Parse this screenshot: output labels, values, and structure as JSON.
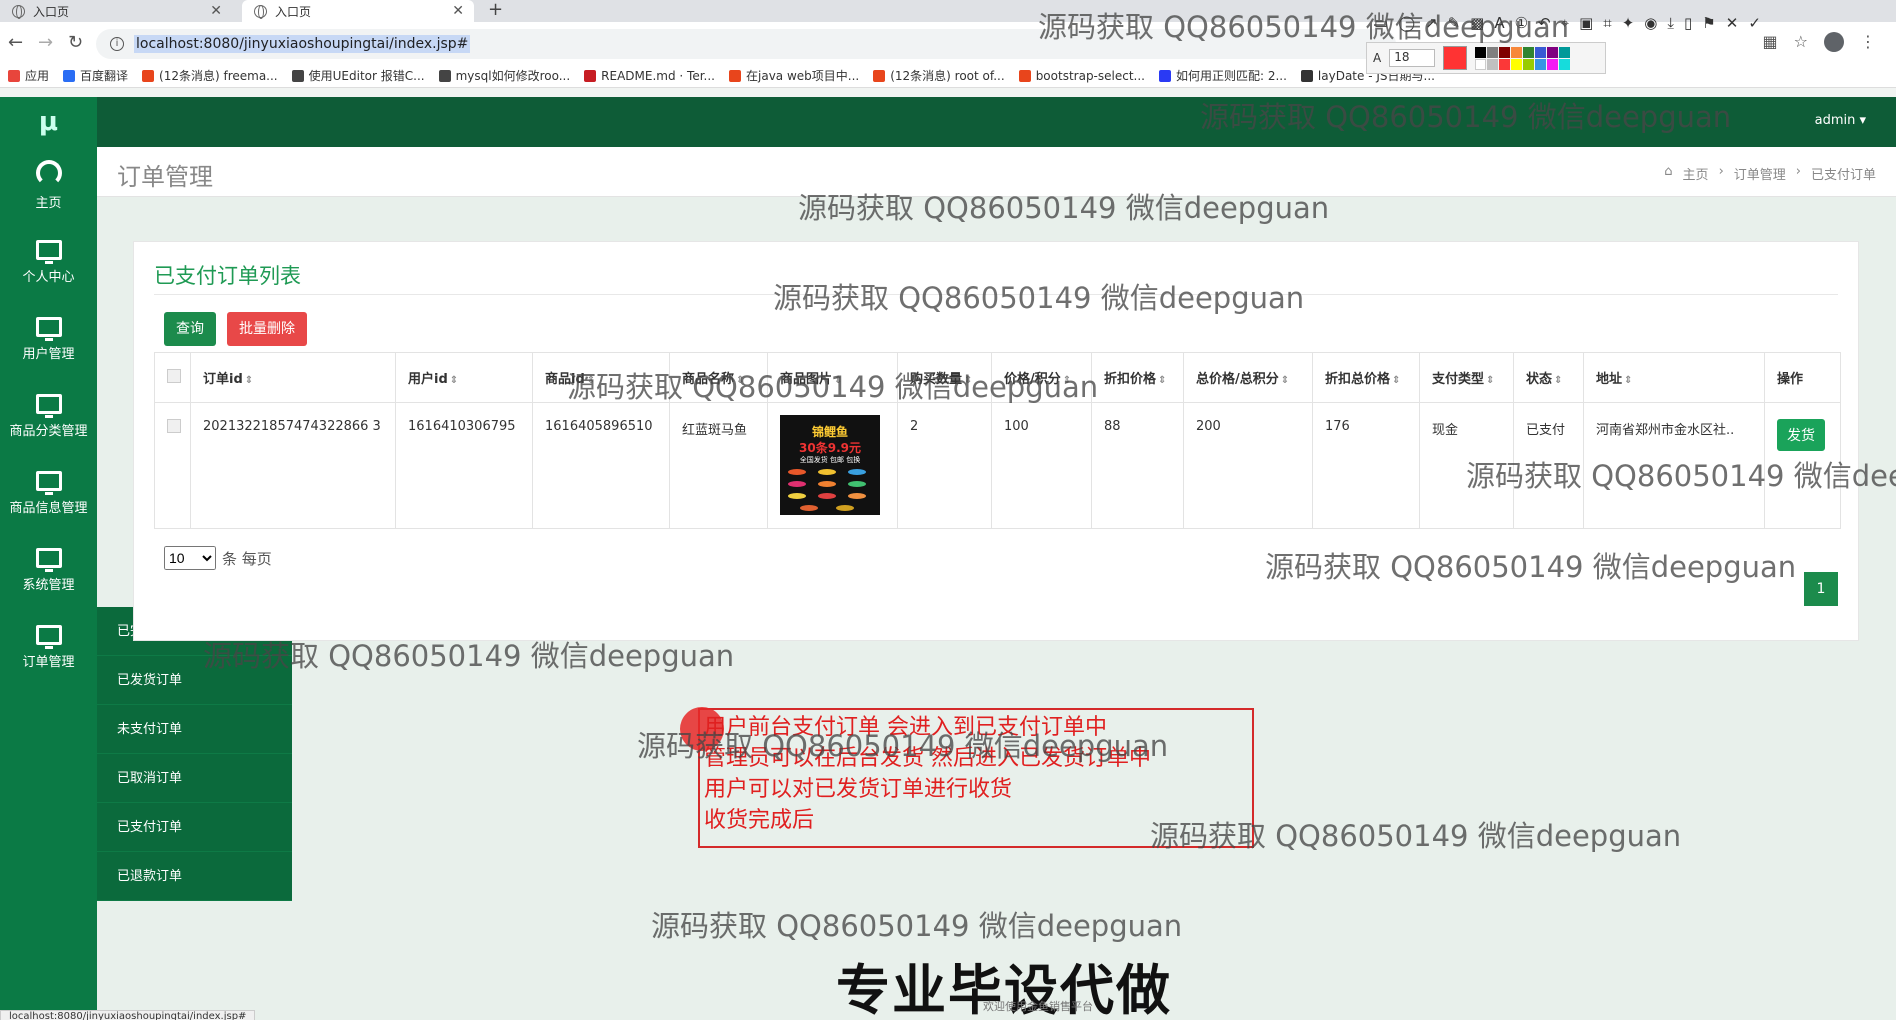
{
  "browser": {
    "tabs": [
      {
        "label": "入口页"
      },
      {
        "label": "入口页"
      }
    ],
    "url": "localhost:8080/jinyuxiaoshoupingtai/index.jsp#",
    "bookmarks": [
      {
        "label": "应用",
        "color": "#e8453c"
      },
      {
        "label": "百度翻译",
        "color": "#2a6df4"
      },
      {
        "label": "(12条消息) freema...",
        "color": "#e8451c"
      },
      {
        "label": "使用UEditor 报错C...",
        "color": "#444444"
      },
      {
        "label": "mysql如何修改roo...",
        "color": "#444444"
      },
      {
        "label": "README.md · Ter...",
        "color": "#c71d23"
      },
      {
        "label": "在java web项目中...",
        "color": "#e8451c"
      },
      {
        "label": "(12条消息) root of...",
        "color": "#e8451c"
      },
      {
        "label": "bootstrap-select...",
        "color": "#e8451c"
      },
      {
        "label": "如何用正则匹配: 2...",
        "color": "#2a3af4"
      },
      {
        "label": "layDate - JS日期与...",
        "color": "#333333"
      }
    ],
    "snip_size": "18"
  },
  "app": {
    "logo": "μ",
    "admin_label": "admin ▾",
    "sidebar": [
      {
        "label": "主页",
        "icon": "dashboard-icon"
      },
      {
        "label": "个人中心",
        "icon": "monitor-icon"
      },
      {
        "label": "用户管理",
        "icon": "monitor-icon"
      },
      {
        "label": "商品分类管理",
        "icon": "monitor-icon"
      },
      {
        "label": "商品信息管理",
        "icon": "monitor-icon"
      },
      {
        "label": "系统管理",
        "icon": "monitor-icon"
      },
      {
        "label": "订单管理",
        "icon": "monitor-icon"
      }
    ],
    "submenu": [
      "已完成订单",
      "已发货订单",
      "未支付订单",
      "已取消订单",
      "已支付订单",
      "已退款订单"
    ],
    "page_title": "订单管理",
    "breadcrumb": [
      "主页",
      "订单管理",
      "已支付订单"
    ],
    "panel_title": "已支付订单列表",
    "btn_query": "查询",
    "btn_delete": "批量删除",
    "columns": [
      "订单id",
      "用户id",
      "商品id",
      "商品名称",
      "商品图片",
      "购买数量",
      "价格/积分",
      "折扣价格",
      "总价格/总积分",
      "折扣总价格",
      "支付类型",
      "状态",
      "地址",
      "操作"
    ],
    "row": {
      "order_id": "20213221857474322866 3",
      "user_id": "1616410306795",
      "goods_id": "1616405896510",
      "goods_name": "红蓝斑马鱼",
      "qty": "2",
      "price": "100",
      "discount_price": "88",
      "total": "200",
      "discount_total": "176",
      "pay_type": "现金",
      "status": "已支付",
      "address": "河南省郑州市金水区社..",
      "action": "发货",
      "img_line1": "锦鲤鱼",
      "img_line2": "30条9.9元",
      "img_line3": "全国发货 包邮 包换"
    },
    "page_size": "10",
    "page_size_label": "条 每页",
    "page_number": "1"
  },
  "annotation": {
    "lines": [
      "用户前台支付订单  会进入到已支付订单中",
      "管理员可以在后台发货  然后进入已发货订单中",
      "用户可以对已发货订单进行收货",
      "收货完成后"
    ]
  },
  "watermark_text": "源码获取 QQ86050149 微信deepguan",
  "banner": "专业毕设代做",
  "footer_small": "欢迎使用金鱼销售平台",
  "status_url": "localhost:8080/jinyuxiaoshoupingtai/index.jsp#"
}
